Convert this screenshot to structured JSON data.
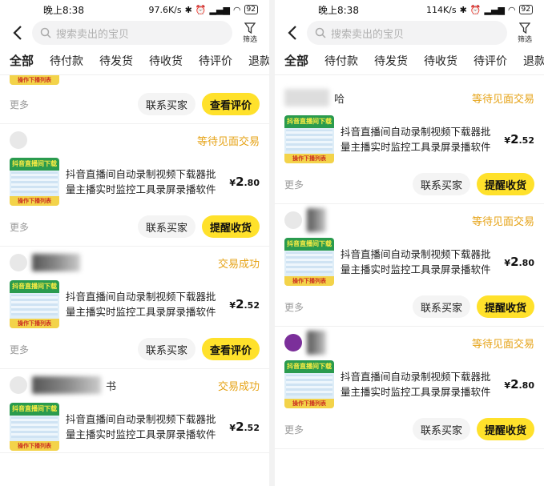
{
  "status_left": {
    "time": "晚上8:38",
    "speed": "97.6K/s",
    "battery": "92"
  },
  "status_right": {
    "time": "晚上8:38",
    "speed": "114K/s",
    "battery": "92"
  },
  "search": {
    "placeholder": "搜索卖出的宝贝"
  },
  "filter_label": "筛选",
  "tabs": [
    "全部",
    "待付款",
    "待发货",
    "待收货",
    "待评价",
    "退款中"
  ],
  "product": {
    "title": "抖音直播间自动录制视频下载器批量主播实时监控工具录屏录播软件",
    "thumb_top": "抖音直播间下载",
    "thumb_bottom": "操作下播列表"
  },
  "labels": {
    "more": "更多",
    "contact": "联系买家",
    "review": "查看评价",
    "remind": "提醒收货",
    "waiting": "等待见面交易",
    "success": "交易成功"
  },
  "left_orders": [
    {
      "status": "",
      "price_int": "",
      "price_dec": "",
      "action": "查看评价"
    },
    {
      "status": "等待见面交易",
      "price_int": "2",
      "price_dec": ".80",
      "action": "提醒收货"
    },
    {
      "status": "交易成功",
      "price_int": "2",
      "price_dec": ".52",
      "action": "查看评价"
    },
    {
      "status": "交易成功",
      "price_int": "2",
      "price_dec": ".52",
      "seller_suffix": "书"
    }
  ],
  "right_orders": [
    {
      "status": "等待见面交易",
      "price_int": "2",
      "price_dec": ".52",
      "action": "提醒收货",
      "seller_suffix": "哈"
    },
    {
      "status": "等待见面交易",
      "price_int": "2",
      "price_dec": ".80",
      "action": "提醒收货"
    },
    {
      "status": "等待见面交易",
      "price_int": "2",
      "price_dec": ".80",
      "action": "提醒收货"
    }
  ],
  "currency": "¥"
}
